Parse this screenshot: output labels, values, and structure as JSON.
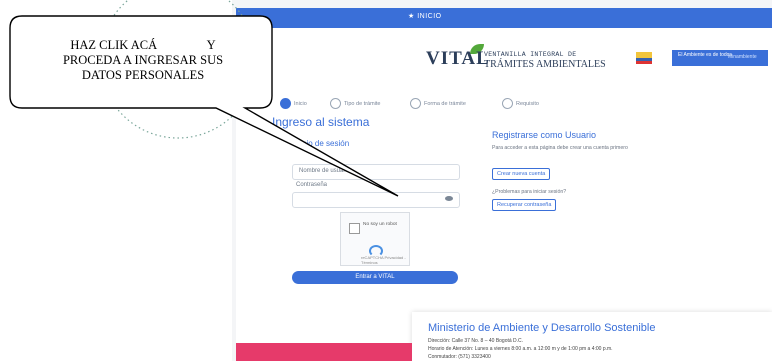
{
  "topbar": {
    "link": "★ INICIO"
  },
  "logo": {
    "name": "VITAL",
    "line1": "VENTANILLA INTEGRAL DE",
    "line2": "TRÁMITES AMBIENTALES",
    "gov": "El Ambiente es de todos",
    "gov_more": "Minambiente"
  },
  "steps": [
    "Inicio",
    "Tipo de trámite",
    "Forma de trámite",
    "Requisito"
  ],
  "login": {
    "title": "Ingreso al sistema",
    "subtitle": "Inicio de sesión",
    "user_label": "Nombre de usuario",
    "password_label": "Contraseña",
    "recaptcha_text": "No soy un robot",
    "recaptcha_sub": "reCAPTCHA Privacidad - Términos",
    "submit": "Entrar a VITAL"
  },
  "register": {
    "title": "Registrarse como Usuario",
    "desc": "Para acceder a esta página debe crear una cuenta primero",
    "create_btn": "Crear nueva cuenta",
    "forgot_text": "¿Problemas para iniciar sesión?",
    "recover_btn": "Recuperar contraseña"
  },
  "footer": {
    "title": "Ministerio de Ambiente y Desarrollo Sostenible",
    "line1": "Dirección: Calle 37 No. 8 – 40 Bogotá D.C.",
    "line2": "Horario de Atención: Lunes a viernes 8:00 a.m. a 12:00 m y de 1:00 pm a 4:00 p.m.",
    "line3": "Conmutador: (571) 3323400"
  },
  "callout": {
    "line1": "HAZ CLIK ACÁ                Y",
    "line2": "PROCEDA A INGRESAR SUS",
    "line3": "DATOS PERSONALES"
  },
  "colors": {
    "accent": "#3a6fd8",
    "pink": "#e63a6a",
    "leaf": "#53a83a"
  }
}
